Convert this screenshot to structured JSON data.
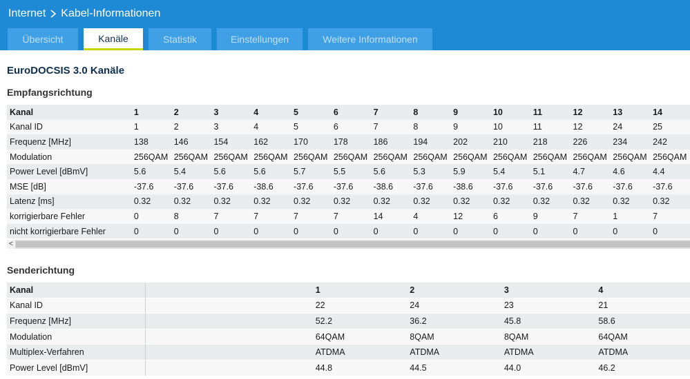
{
  "breadcrumb": {
    "root": "Internet",
    "current": "Kabel-Informationen"
  },
  "tabs": [
    {
      "label": "Übersicht",
      "active": false
    },
    {
      "label": "Kanäle",
      "active": true
    },
    {
      "label": "Statistik",
      "active": false
    },
    {
      "label": "Einstellungen",
      "active": false
    },
    {
      "label": "Weitere Informationen",
      "active": false
    }
  ],
  "page_title": "EuroDOCSIS 3.0 Kanäle",
  "downstream": {
    "heading": "Empfangsrichtung",
    "rows": [
      {
        "label": "Kanal",
        "values": [
          "1",
          "2",
          "3",
          "4",
          "5",
          "6",
          "7",
          "8",
          "9",
          "10",
          "11",
          "12",
          "13",
          "14"
        ]
      },
      {
        "label": "Kanal ID",
        "values": [
          "1",
          "2",
          "3",
          "4",
          "5",
          "6",
          "7",
          "8",
          "9",
          "10",
          "11",
          "12",
          "24",
          "25"
        ]
      },
      {
        "label": "Frequenz [MHz]",
        "values": [
          "138",
          "146",
          "154",
          "162",
          "170",
          "178",
          "186",
          "194",
          "202",
          "210",
          "218",
          "226",
          "234",
          "242"
        ]
      },
      {
        "label": "Modulation",
        "values": [
          "256QAM",
          "256QAM",
          "256QAM",
          "256QAM",
          "256QAM",
          "256QAM",
          "256QAM",
          "256QAM",
          "256QAM",
          "256QAM",
          "256QAM",
          "256QAM",
          "256QAM",
          "256QAM"
        ]
      },
      {
        "label": "Power Level [dBmV]",
        "values": [
          "5.6",
          "5.4",
          "5.6",
          "5.6",
          "5.7",
          "5.5",
          "5.6",
          "5.3",
          "5.9",
          "5.4",
          "5.1",
          "4.7",
          "4.6",
          "4.4"
        ]
      },
      {
        "label": "MSE [dB]",
        "values": [
          "-37.6",
          "-37.6",
          "-37.6",
          "-38.6",
          "-37.6",
          "-37.6",
          "-38.6",
          "-37.6",
          "-38.6",
          "-37.6",
          "-37.6",
          "-37.6",
          "-37.6",
          "-37.6"
        ]
      },
      {
        "label": "Latenz [ms]",
        "values": [
          "0.32",
          "0.32",
          "0.32",
          "0.32",
          "0.32",
          "0.32",
          "0.32",
          "0.32",
          "0.32",
          "0.32",
          "0.32",
          "0.32",
          "0.32",
          "0.32"
        ]
      },
      {
        "label": "korrigierbare Fehler",
        "values": [
          "0",
          "8",
          "7",
          "7",
          "7",
          "7",
          "14",
          "4",
          "12",
          "6",
          "9",
          "7",
          "1",
          "7"
        ]
      },
      {
        "label": "nicht korrigierbare Fehler",
        "values": [
          "0",
          "0",
          "0",
          "0",
          "0",
          "0",
          "0",
          "0",
          "0",
          "0",
          "0",
          "0",
          "0",
          "0"
        ]
      }
    ]
  },
  "upstream": {
    "heading": "Senderichtung",
    "rows": [
      {
        "label": "Kanal",
        "values": [
          "1",
          "2",
          "3",
          "4"
        ]
      },
      {
        "label": "Kanal ID",
        "values": [
          "22",
          "24",
          "23",
          "21"
        ]
      },
      {
        "label": "Frequenz [MHz]",
        "values": [
          "52.2",
          "36.2",
          "45.8",
          "58.6"
        ]
      },
      {
        "label": "Modulation",
        "values": [
          "64QAM",
          "8QAM",
          "8QAM",
          "64QAM"
        ]
      },
      {
        "label": "Multiplex-Verfahren",
        "values": [
          "ATDMA",
          "ATDMA",
          "ATDMA",
          "ATDMA"
        ]
      },
      {
        "label": "Power Level [dBmV]",
        "values": [
          "44.8",
          "44.5",
          "44.0",
          "46.2"
        ]
      }
    ]
  },
  "scrollbar": {
    "left_arrow": "<"
  },
  "colors": {
    "header_bg": "#1e8ad6",
    "tab_bg": "#3fa0e6",
    "active_underline": "#c6d60a",
    "title": "#0d2f52"
  }
}
